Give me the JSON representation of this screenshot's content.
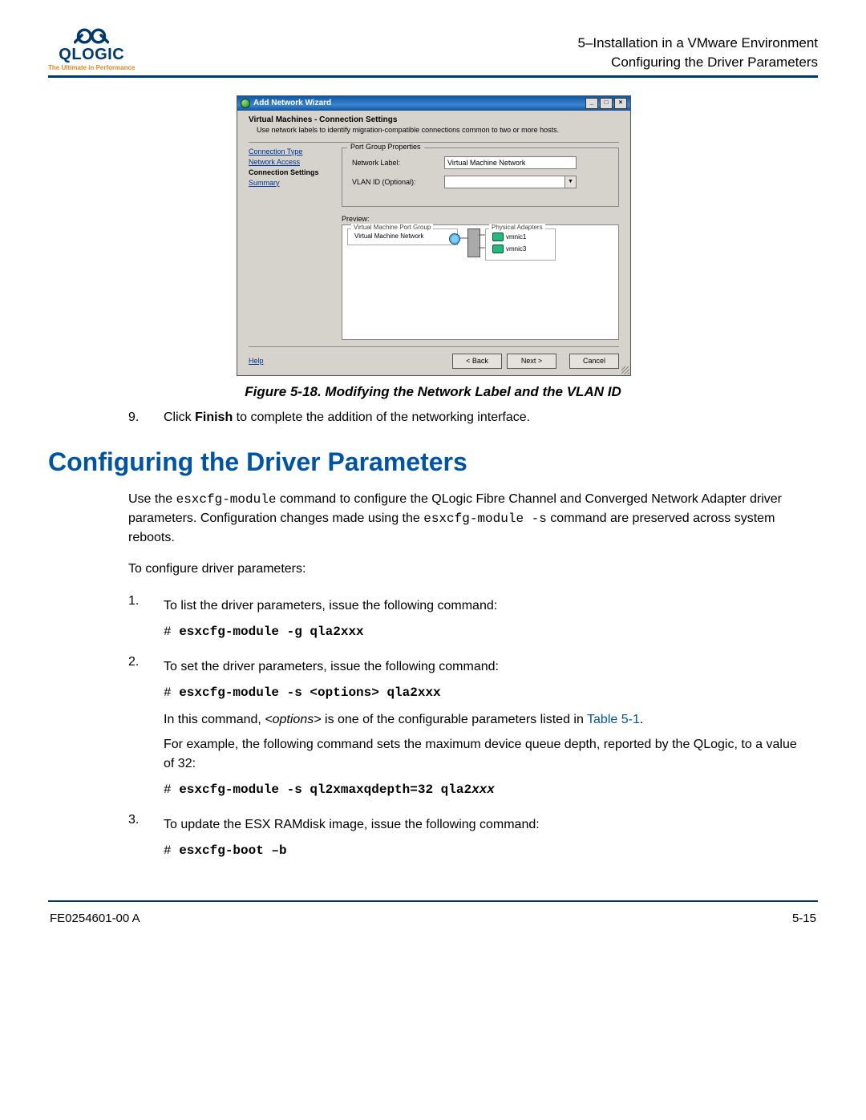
{
  "header": {
    "logo_brand": "QLOGIC",
    "logo_tag": "The Ultimate in Performance",
    "chapter_line1": "5–Installation in a VMware Environment",
    "chapter_line2": "Configuring the Driver Parameters"
  },
  "wizard": {
    "title": "Add Network Wizard",
    "head_title": "Virtual Machines - Connection Settings",
    "head_desc": "Use network labels to identify migration-compatible connections common to two or more hosts.",
    "nav": {
      "item0": "Connection Type",
      "item1": "Network Access",
      "item2": "Connection Settings",
      "item3": "Summary"
    },
    "group_legend": "Port Group Properties",
    "label_network": "Network Label:",
    "value_network": "Virtual Machine Network",
    "label_vlan": "VLAN ID (Optional):",
    "value_vlan": "",
    "preview_label": "Preview:",
    "preview_vm_group_legend": "Virtual Machine Port Group",
    "preview_vm_group_value": "Virtual Machine Network",
    "preview_phys_legend": "Physical Adapters",
    "preview_nic1": "vmnic1",
    "preview_nic3": "vmnic3",
    "help": "Help",
    "back": "< Back",
    "next": "Next >",
    "cancel": "Cancel"
  },
  "figure_caption": "Figure 5-18. Modifying the Network Label and the VLAN ID",
  "step9_num": "9.",
  "step9_text_a": "Click ",
  "step9_text_bold": "Finish",
  "step9_text_b": " to complete the addition of the networking interface.",
  "section_title": "Configuring the Driver Parameters",
  "intro_a": "Use the ",
  "intro_code1": "esxcfg-module",
  "intro_b": " command to configure the QLogic Fibre Channel and Converged Network Adapter driver parameters. Configuration changes made using the ",
  "intro_code2": "esxcfg-module -s",
  "intro_c": " command are preserved across system reboots.",
  "intro_lead": "To configure driver parameters:",
  "s1_num": "1.",
  "s1_text": "To list the driver parameters, issue the following command:",
  "s1_prompt": "# ",
  "s1_cmd": "esxcfg-module -g qla2xxx",
  "s2_num": "2.",
  "s2_text": "To set the driver parameters, issue the following command:",
  "s2_prompt": "# ",
  "s2_cmd": "esxcfg-module -s <options> qla2xxx",
  "s2_note_a": "In this command, ",
  "s2_note_i": "<options>",
  "s2_note_b": " is one of the configurable parameters listed in ",
  "s2_note_link": "Table 5-1",
  "s2_note_c": ".",
  "s2_example": "For example, the following command sets the maximum device queue depth, reported by the QLogic, to a value of 32:",
  "s2_prompt2": "# ",
  "s2_cmd2a": "esxcfg-module -s ql2xmaxqdepth=32 qla2",
  "s2_cmd2b": "xxx",
  "s3_num": "3.",
  "s3_text": "To update the ESX RAMdisk image, issue the following command:",
  "s3_prompt": "# ",
  "s3_cmd": "esxcfg-boot –b",
  "footer_left": "FE0254601-00 A",
  "footer_right": "5-15"
}
